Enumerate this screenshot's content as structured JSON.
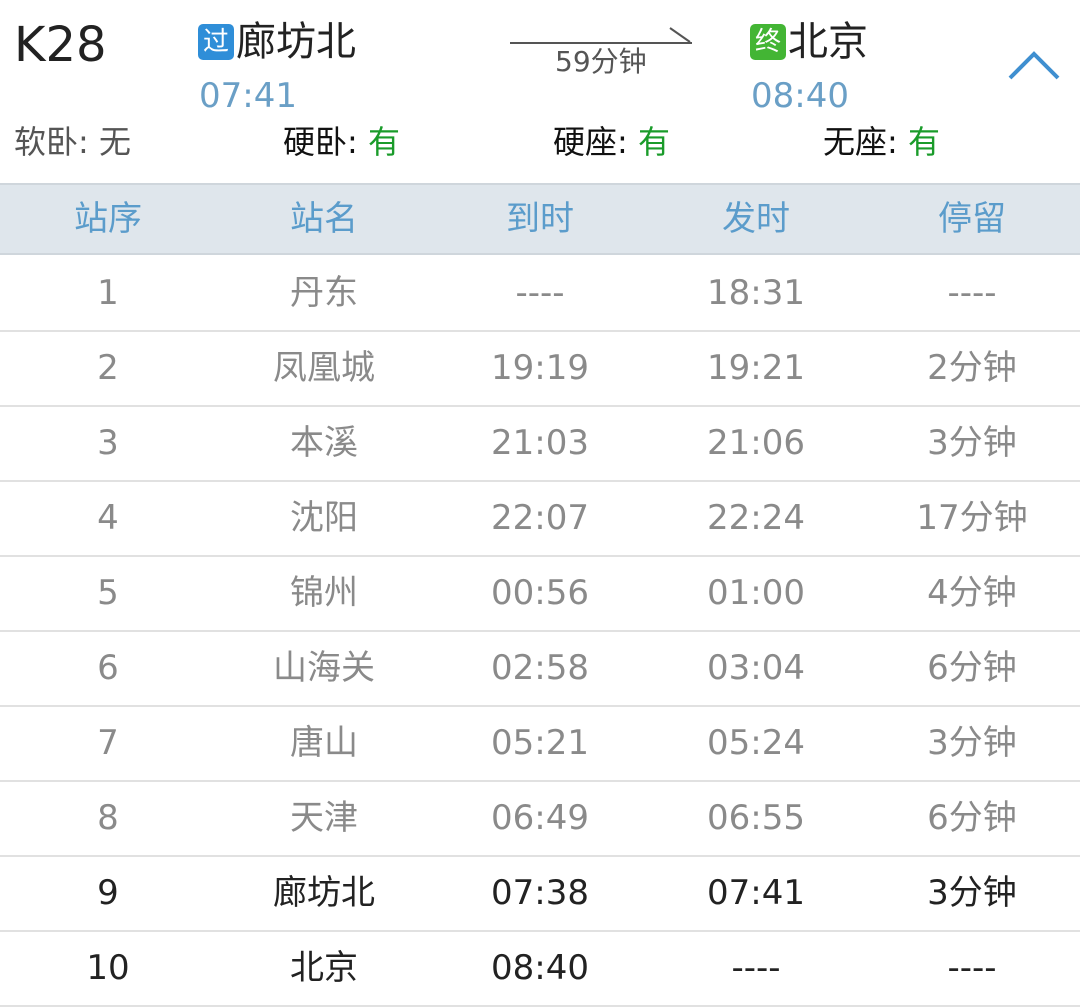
{
  "train": {
    "number": "K28",
    "from": {
      "badge": "过",
      "badge_color": "#2f8ed8",
      "name": "廊坊北",
      "time": "07:41"
    },
    "to": {
      "badge": "终",
      "badge_color": "#43b534",
      "name": "北京",
      "time": "08:40"
    },
    "duration": "59分钟"
  },
  "seats": [
    {
      "label": "软卧: ",
      "value": "无"
    },
    {
      "label": "硬卧: ",
      "value": "有"
    },
    {
      "label": "硬座: ",
      "value": "有"
    },
    {
      "label": "无座: ",
      "value": "有"
    }
  ],
  "icons": {
    "collapse": "chevron-up-icon",
    "arrow": "arrow-right-icon"
  },
  "colors": {
    "accent": "#5b9ccb",
    "available": "#1a9b2a",
    "header_bg": "#dfe6ec"
  },
  "table": {
    "columns": [
      "站序",
      "站名",
      "到时",
      "发时",
      "停留"
    ],
    "rows": [
      [
        "1",
        "丹东",
        "----",
        "18:31",
        "----"
      ],
      [
        "2",
        "凤凰城",
        "19:19",
        "19:21",
        "2分钟"
      ],
      [
        "3",
        "本溪",
        "21:03",
        "21:06",
        "3分钟"
      ],
      [
        "4",
        "沈阳",
        "22:07",
        "22:24",
        "17分钟"
      ],
      [
        "5",
        "锦州",
        "00:56",
        "01:00",
        "4分钟"
      ],
      [
        "6",
        "山海关",
        "02:58",
        "03:04",
        "6分钟"
      ],
      [
        "7",
        "唐山",
        "05:21",
        "05:24",
        "3分钟"
      ],
      [
        "8",
        "天津",
        "06:49",
        "06:55",
        "6分钟"
      ],
      [
        "9",
        "廊坊北",
        "07:38",
        "07:41",
        "3分钟"
      ],
      [
        "10",
        "北京",
        "08:40",
        "----",
        "----"
      ]
    ]
  }
}
